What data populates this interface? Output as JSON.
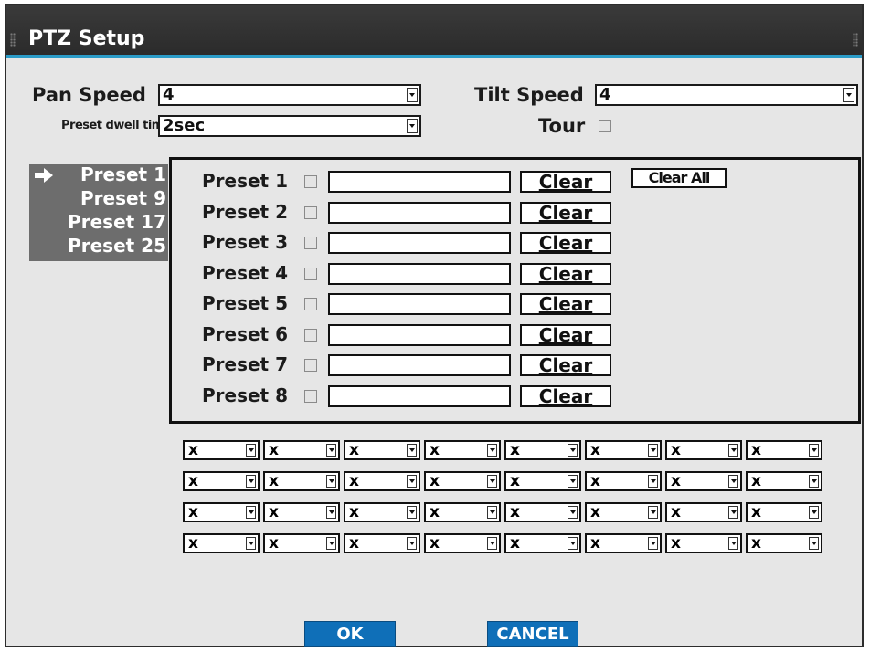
{
  "window": {
    "title": "PTZ Setup",
    "accent_color": "#2b9cc8"
  },
  "settings": {
    "pan_speed_label": "Pan Speed",
    "pan_speed_value": "4",
    "tilt_speed_label": "Tilt Speed",
    "tilt_speed_value": "4",
    "dwell_label": "Preset dwell time",
    "dwell_value": "2sec",
    "tour_label": "Tour"
  },
  "sidebar": {
    "items": [
      "Preset 1",
      "Preset 9",
      "Preset 17",
      "Preset 25"
    ],
    "selected": 0
  },
  "presets": {
    "rows": [
      {
        "label": "Preset 1",
        "clear": "Clear"
      },
      {
        "label": "Preset 2",
        "clear": "Clear"
      },
      {
        "label": "Preset 3",
        "clear": "Clear"
      },
      {
        "label": "Preset 4",
        "clear": "Clear"
      },
      {
        "label": "Preset 5",
        "clear": "Clear"
      },
      {
        "label": "Preset 6",
        "clear": "Clear"
      },
      {
        "label": "Preset 7",
        "clear": "Clear"
      },
      {
        "label": "Preset 8",
        "clear": "Clear"
      }
    ],
    "clear_all": "Clear All"
  },
  "tour_grid": {
    "cell_value": "x",
    "rows": 4,
    "cols": 8
  },
  "footer": {
    "ok": "OK",
    "cancel": "CANCEL",
    "button_color": "#0f6fb8"
  }
}
